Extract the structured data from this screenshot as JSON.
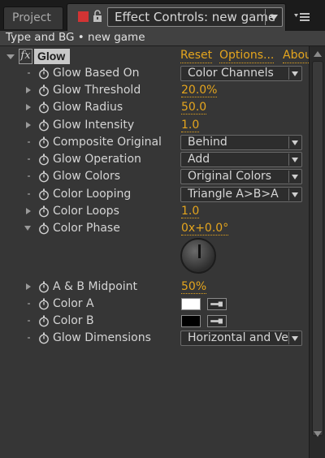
{
  "tabs": {
    "project_label": "Project",
    "active_label": "Effect Controls: new game"
  },
  "header": {
    "title": "Type and BG • new game"
  },
  "effect": {
    "name": "Glow",
    "fx_glyph": "fx",
    "reset_label": "Reset",
    "options_label": "Options...",
    "about_label": "Abou"
  },
  "params": {
    "glow_based_on": {
      "label": "Glow Based On",
      "value": "Color Channels"
    },
    "glow_threshold": {
      "label": "Glow Threshold",
      "value": "20.0%"
    },
    "glow_radius": {
      "label": "Glow Radius",
      "value": "50.0"
    },
    "glow_intensity": {
      "label": "Glow Intensity",
      "value": "1.0"
    },
    "composite_original": {
      "label": "Composite Original",
      "value": "Behind"
    },
    "glow_operation": {
      "label": "Glow Operation",
      "value": "Add"
    },
    "glow_colors": {
      "label": "Glow Colors",
      "value": "Original Colors"
    },
    "color_looping": {
      "label": "Color Looping",
      "value": "Triangle A>B>A"
    },
    "color_loops": {
      "label": "Color Loops",
      "value": "1.0"
    },
    "color_phase": {
      "label": "Color Phase",
      "value": "0x+0.0°"
    },
    "ab_midpoint": {
      "label": "A & B Midpoint",
      "value": "50%"
    },
    "color_a": {
      "label": "Color A",
      "color": "#ffffff"
    },
    "color_b": {
      "label": "Color B",
      "color": "#000000"
    },
    "glow_dimensions": {
      "label": "Glow Dimensions",
      "value": "Horizontal and Ve"
    }
  },
  "colors": {
    "accent": "#e4a51e",
    "record": "#d23434"
  },
  "icons": [
    "red-square-icon",
    "lock-icon",
    "panel-menu-icon",
    "fx-icon",
    "stopwatch-icon",
    "eyedropper-icon",
    "dial"
  ]
}
